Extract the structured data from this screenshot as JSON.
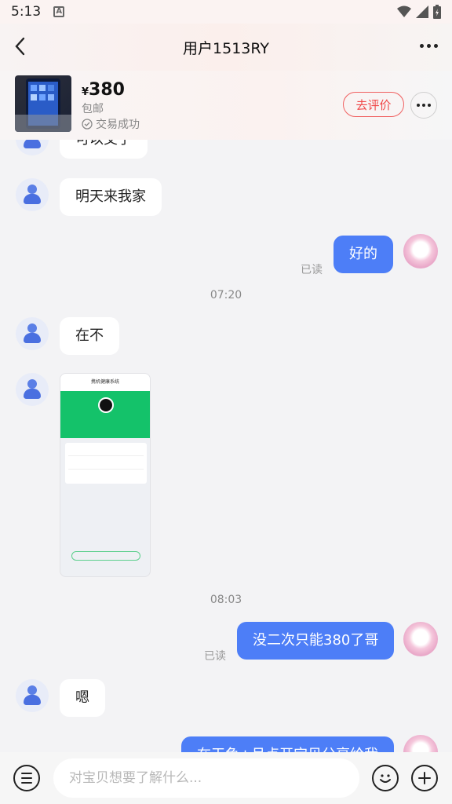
{
  "status": {
    "time": "5:13",
    "a_icon": "A"
  },
  "header": {
    "title": "用户1513RY"
  },
  "product": {
    "currency": "¥",
    "price": "380",
    "shipping": "包邮",
    "deal_status": "交易成功",
    "rate_button": "去评价"
  },
  "messages": {
    "m1_partial": "可以交了",
    "m2": "明天来我家",
    "m3": "好的",
    "m3_read": "已读",
    "time1": "07:20",
    "m4": "在不",
    "shot_title": "携机健康系统",
    "time2": "08:03",
    "m6": "没二次只能380了哥",
    "m6_read": "已读",
    "m7": "嗯",
    "m8_partial": "在干鱼+月点开宝贝分享给我"
  },
  "input": {
    "placeholder": "对宝贝想要了解什么..."
  }
}
